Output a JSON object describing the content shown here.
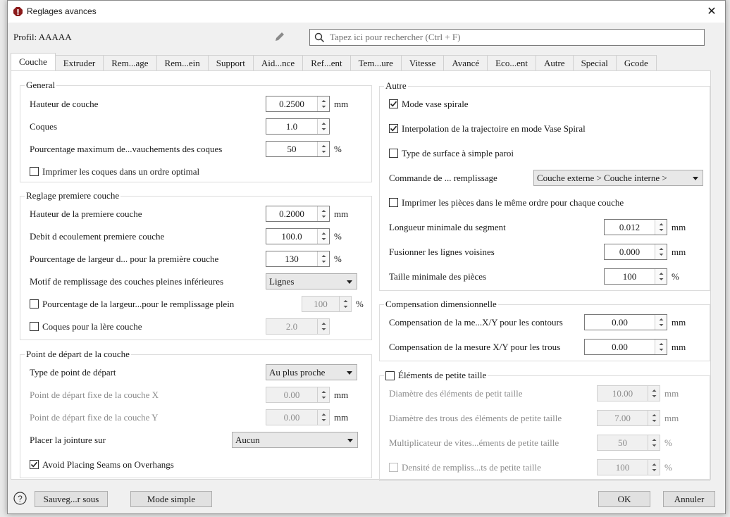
{
  "window": {
    "title": "Reglages avances",
    "close_icon": "close-icon"
  },
  "profile": {
    "label": "Profil: AAAAA"
  },
  "search": {
    "placeholder": "Tapez ici pour rechercher (Ctrl + F)",
    "value": ""
  },
  "tabs": [
    {
      "label": "Couche",
      "active": true
    },
    {
      "label": "Extruder"
    },
    {
      "label": "Rem...age"
    },
    {
      "label": "Rem...ein"
    },
    {
      "label": "Support"
    },
    {
      "label": "Aid...nce"
    },
    {
      "label": "Ref...ent"
    },
    {
      "label": "Tem...ure"
    },
    {
      "label": "Vitesse"
    },
    {
      "label": "Avancé"
    },
    {
      "label": "Eco...ent"
    },
    {
      "label": "Autre"
    },
    {
      "label": "Special"
    },
    {
      "label": "Gcode"
    }
  ],
  "groups": [
    {
      "id": "general",
      "title": "General",
      "rows": [
        {
          "label": "Hauteur de couche",
          "type": "spin",
          "value": "0.2500",
          "unit": "mm"
        },
        {
          "label": "Coques",
          "type": "spin",
          "value": "1.0",
          "unit": ""
        },
        {
          "label": "Pourcentage maximum de...vauchements des coques",
          "type": "spin",
          "value": "50",
          "unit": "%"
        },
        {
          "label": "Imprimer les coques dans un ordre optimal",
          "type": "check",
          "checked": false
        }
      ]
    },
    {
      "id": "premiere-couche",
      "title": "Reglage premiere couche",
      "rows": [
        {
          "label": "Hauteur de la premiere couche",
          "type": "spin",
          "value": "0.2000",
          "unit": "mm"
        },
        {
          "label": "Debit d ecoulement premiere couche",
          "type": "spin",
          "value": "100.0",
          "unit": "%"
        },
        {
          "label": "Pourcentage de largeur d... pour la première couche",
          "type": "spin",
          "value": "130",
          "unit": "%"
        },
        {
          "label": "Motif de remplissage des couches pleines inférieures",
          "type": "select",
          "value": "Lignes"
        },
        {
          "label": "Pourcentage de la largeur...pour le remplissage plein",
          "type": "checkspin",
          "checked": false,
          "value": "100",
          "unit": "%",
          "disabled": true
        },
        {
          "label": "Coques pour la lère couche",
          "type": "checkspin",
          "checked": false,
          "value": "2.0",
          "unit": "",
          "disabled": true
        }
      ]
    },
    {
      "id": "point-depart",
      "title": "Point de départ de la couche",
      "rows": [
        {
          "label": "Type de point de départ",
          "type": "select",
          "value": "Au plus proche"
        },
        {
          "label": "Point de départ fixe de la couche X",
          "type": "spin",
          "value": "0.00",
          "unit": "mm",
          "disabled": true
        },
        {
          "label": "Point de départ fixe de la couche Y",
          "type": "spin",
          "value": "0.00",
          "unit": "mm",
          "disabled": true
        },
        {
          "label": "Placer la jointure sur",
          "type": "select",
          "value": "Aucun"
        },
        {
          "label": "Avoid Placing Seams on Overhangs",
          "type": "check",
          "checked": true
        }
      ]
    },
    {
      "id": "autre",
      "title": "Autre",
      "rows": [
        {
          "label": "Mode vase spirale",
          "type": "check",
          "checked": true
        },
        {
          "label": "Interpolation de la trajectoire en mode Vase Spiral",
          "type": "check",
          "checked": true
        },
        {
          "label": "Type de surface à simple paroi",
          "type": "check",
          "checked": false
        },
        {
          "label": "Commande de ... remplissage",
          "type": "select",
          "value": "Couche externe > Couche interne > Remplissage"
        },
        {
          "label": "Imprimer les pièces dans le même ordre pour chaque couche",
          "type": "check",
          "checked": false
        },
        {
          "label": "Longueur minimale du segment",
          "type": "spin",
          "value": "0.012",
          "unit": "mm"
        },
        {
          "label": "Fusionner les lignes voisines",
          "type": "spin",
          "value": "0.000",
          "unit": "mm"
        },
        {
          "label": "Taille minimale des pièces",
          "type": "spin",
          "value": "100",
          "unit": "%"
        }
      ]
    },
    {
      "id": "compensation",
      "title": "Compensation dimensionnelle",
      "rows": [
        {
          "label": "Compensation de la me...X/Y pour les contours",
          "type": "spin",
          "value": "0.00",
          "unit": "mm"
        },
        {
          "label": "Compensation de la mesure X/Y pour les trous",
          "type": "spin",
          "value": "0.00",
          "unit": "mm"
        }
      ]
    },
    {
      "id": "petite-taille",
      "title": "Éléments de petite taille",
      "title_checkbox": true,
      "checked": false,
      "rows": [
        {
          "label": "Diamètre des éléments de petit taille",
          "type": "spin",
          "value": "10.00",
          "unit": "mm",
          "disabled": true
        },
        {
          "label": "Diamètre des trous des éléments de petite taille",
          "type": "spin",
          "value": "7.00",
          "unit": "mm",
          "disabled": true
        },
        {
          "label": "Multiplicateur de vites...éments de petite taille",
          "type": "spin",
          "value": "50",
          "unit": "%",
          "disabled": true
        },
        {
          "label": "Densité de rempliss...ts de petite taille",
          "type": "checkspin",
          "checked": false,
          "value": "100",
          "unit": "%",
          "disabled": true
        }
      ]
    }
  ],
  "footer": {
    "help_icon": "help-icon",
    "save_as": "Sauveg...r sous",
    "simple_mode": "Mode simple",
    "ok": "OK",
    "cancel": "Annuler"
  },
  "colors": {
    "window_icon": "#8b1a1a",
    "panel": "#ffffff",
    "dialog": "#f0f0f0"
  }
}
